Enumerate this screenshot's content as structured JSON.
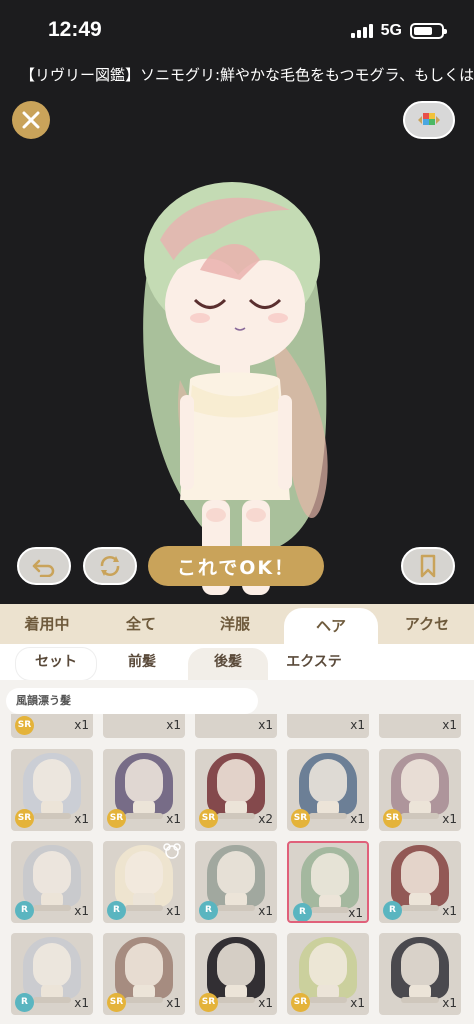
{
  "status": {
    "time": "12:49",
    "network": "5G"
  },
  "ticker": {
    "text": "【リヴリー図鑑】ソニモグリ:鮮やかな毛色をもつモグラ、もしくは"
  },
  "stage": {
    "ok_label": "これでOK！"
  },
  "tabs": {
    "main": [
      "着用中",
      "全て",
      "洋服",
      "ヘア",
      "アクセ"
    ],
    "sub": [
      "セット",
      "前髪",
      "後髪",
      "エクステ"
    ]
  },
  "series_label": "風韻漂う髪",
  "items": {
    "row0": [
      "x1",
      "x1",
      "x1",
      "x1",
      "x1"
    ],
    "row0_rarity": "SR",
    "row1": [
      {
        "rarity": "SR",
        "qty": "x1",
        "hair": "#c9cdd6"
      },
      {
        "rarity": "SR",
        "qty": "x1",
        "hair": "#6b6080"
      },
      {
        "rarity": "SR",
        "qty": "x2",
        "hair": "#7a3a3e"
      },
      {
        "rarity": "SR",
        "qty": "x1",
        "hair": "#5f7690"
      },
      {
        "rarity": "SR",
        "qty": "x1",
        "hair": "#a88e96"
      }
    ],
    "row2": [
      {
        "rarity": "R",
        "qty": "x1",
        "hair": "#c7c9cd"
      },
      {
        "rarity": "R",
        "qty": "x1",
        "hair": "#efe6cf"
      },
      {
        "rarity": "R",
        "qty": "x1",
        "hair": "#9aa39a"
      },
      {
        "rarity": "R",
        "qty": "x1",
        "hair": "#9db59a"
      },
      {
        "rarity": "R",
        "qty": "x1",
        "hair": "#8a4a48"
      }
    ],
    "row3": [
      {
        "rarity": "R",
        "qty": "x1",
        "hair": "#c9cbd0"
      },
      {
        "rarity": "SR",
        "qty": "x1",
        "hair": "#a08478"
      },
      {
        "rarity": "SR",
        "qty": "x1",
        "hair": "#1f1d22"
      },
      {
        "rarity": "SR",
        "qty": "x1",
        "hair": "#c9cf98"
      },
      {
        "rarity": "",
        "qty": "x1",
        "hair": "#3a3a40"
      }
    ]
  },
  "colors": {
    "accent_gold": "#c9a35a",
    "selected_border": "#e0607a",
    "rarity_sr": "#e4b33a",
    "rarity_r": "#5ab5c0"
  }
}
